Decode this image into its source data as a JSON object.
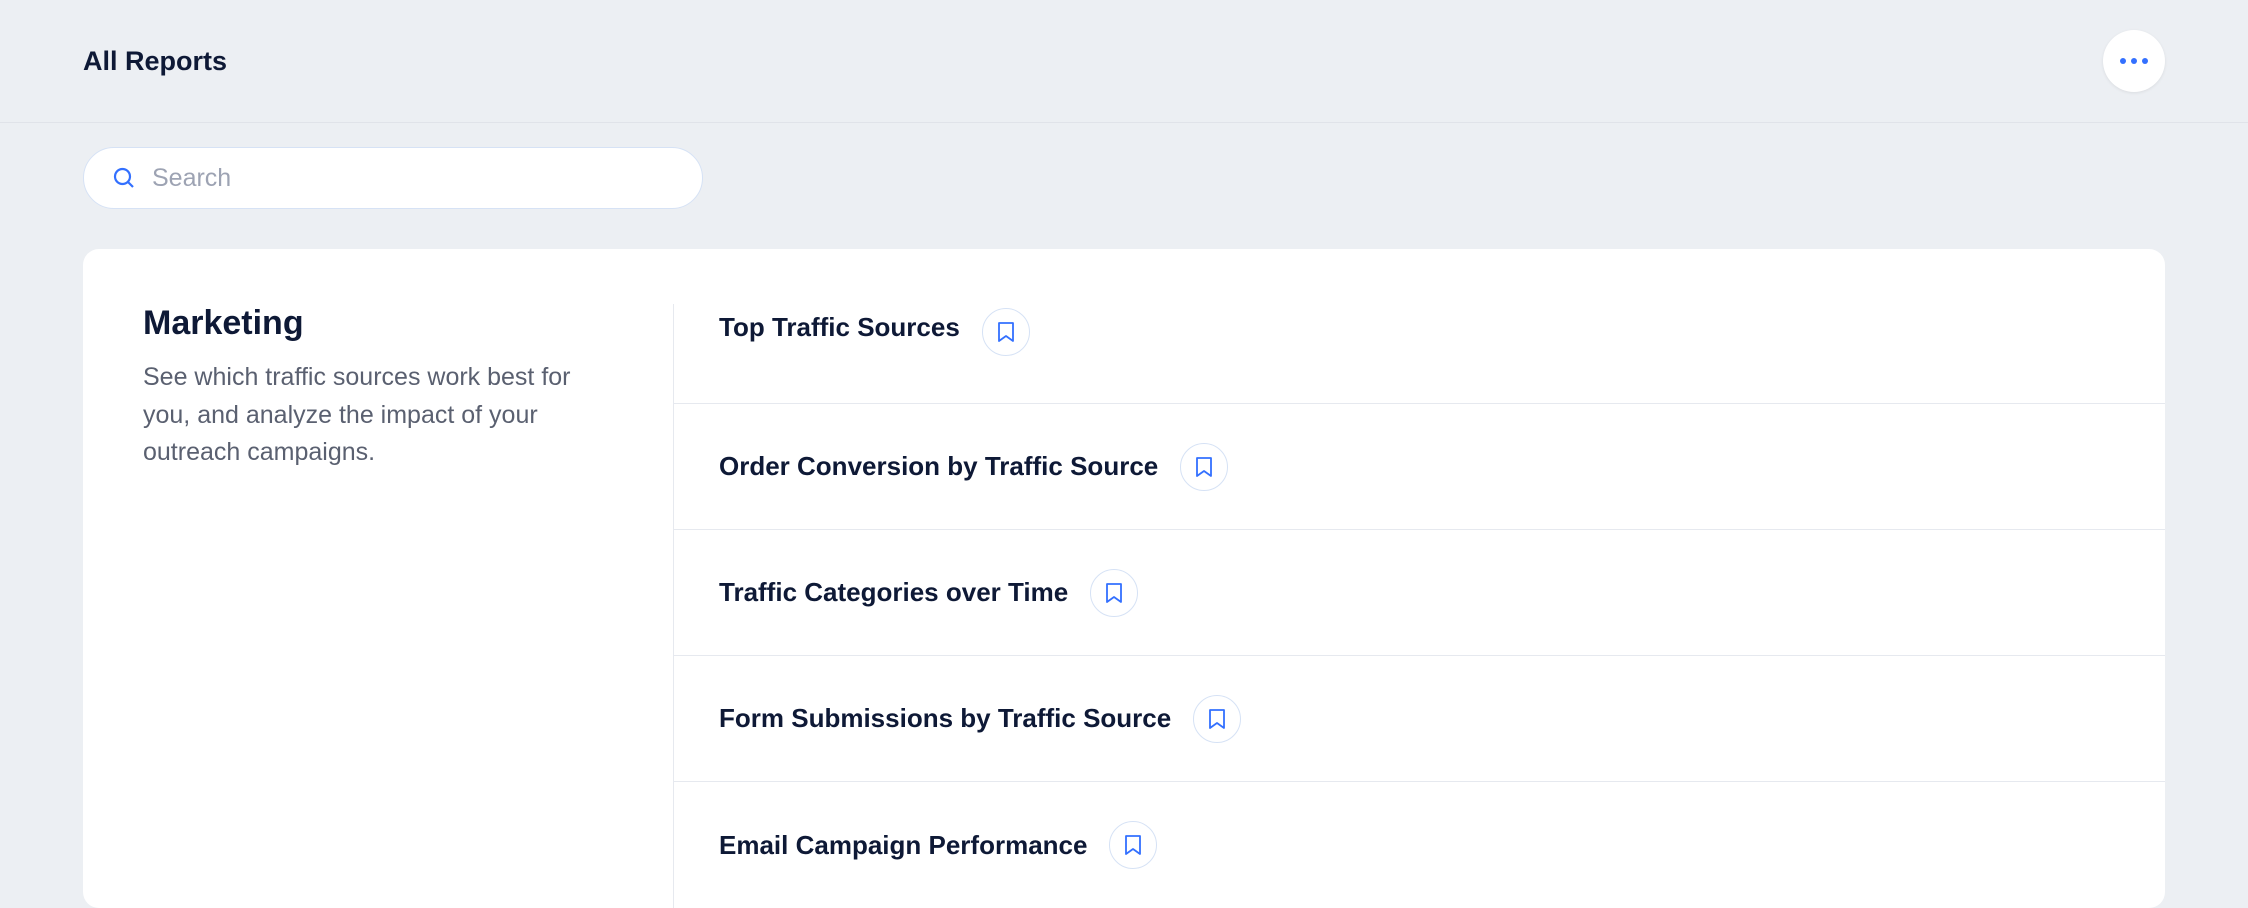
{
  "header": {
    "title": "All Reports"
  },
  "search": {
    "placeholder": "Search"
  },
  "category": {
    "title": "Marketing",
    "description": "See which traffic sources work best for you, and analyze the impact of your outreach campaigns."
  },
  "reports": [
    {
      "name": "Top Traffic Sources"
    },
    {
      "name": "Order Conversion by Traffic Source"
    },
    {
      "name": "Traffic Categories over Time"
    },
    {
      "name": "Form Submissions by Traffic Source"
    },
    {
      "name": "Email Campaign Performance"
    }
  ]
}
